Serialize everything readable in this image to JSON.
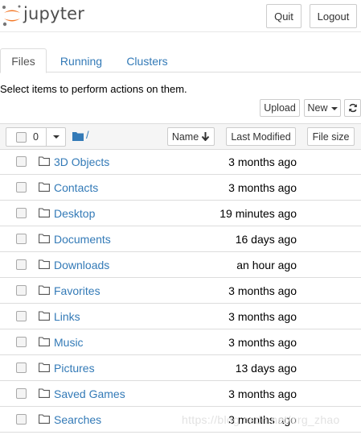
{
  "header": {
    "logo_text": "jupyter",
    "quit_label": "Quit",
    "logout_label": "Logout"
  },
  "tabs": [
    {
      "label": "Files",
      "active": true
    },
    {
      "label": "Running",
      "active": false
    },
    {
      "label": "Clusters",
      "active": false
    }
  ],
  "instructions": "Select items to perform actions on them.",
  "toolbar": {
    "upload_label": "Upload",
    "new_label": "New",
    "refresh_icon": "refresh-icon"
  },
  "list_header": {
    "selected_count": "0",
    "breadcrumb": "/",
    "name_label": "Name",
    "last_modified_label": "Last Modified",
    "file_size_label": "File size"
  },
  "files": [
    {
      "name": "3D Objects",
      "modified": "3 months ago"
    },
    {
      "name": "Contacts",
      "modified": "3 months ago"
    },
    {
      "name": "Desktop",
      "modified": "19 minutes ago"
    },
    {
      "name": "Documents",
      "modified": "16 days ago"
    },
    {
      "name": "Downloads",
      "modified": "an hour ago"
    },
    {
      "name": "Favorites",
      "modified": "3 months ago"
    },
    {
      "name": "Links",
      "modified": "3 months ago"
    },
    {
      "name": "Music",
      "modified": "3 months ago"
    },
    {
      "name": "Pictures",
      "modified": "13 days ago"
    },
    {
      "name": "Saved Games",
      "modified": "3 months ago"
    },
    {
      "name": "Searches",
      "modified": "3 months ago"
    }
  ],
  "watermark": "https://blog.csdn.net/org_zhao",
  "colors": {
    "link": "#337ab7",
    "logo_orange": "#f37726",
    "border": "#dddddd"
  }
}
